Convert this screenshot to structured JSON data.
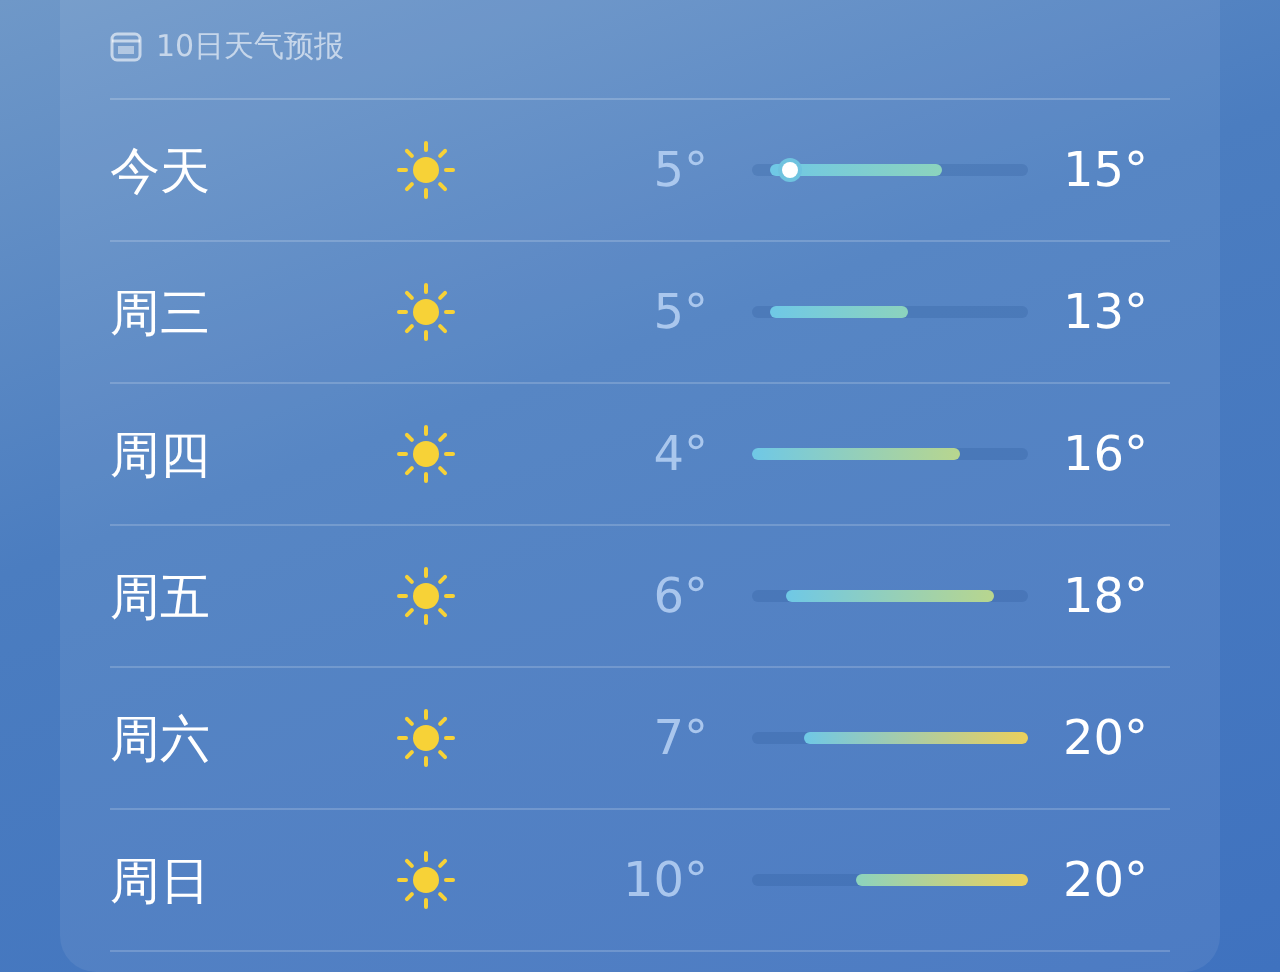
{
  "forecast": {
    "title": "10日天气预报",
    "days": [
      {
        "day": "今天",
        "kind": "sun",
        "low": "5°",
        "high": "15°",
        "now_marker": true,
        "level": 0.12
      },
      {
        "day": "周三",
        "kind": "sun",
        "low": "5°",
        "high": "13°",
        "now_marker": false
      },
      {
        "day": "周四",
        "kind": "sun",
        "low": "4°",
        "high": "16°",
        "now_marker": false
      },
      {
        "day": "周五",
        "kind": "sun",
        "low": "6°",
        "high": "18°",
        "now_marker": false
      },
      {
        "day": "周六",
        "kind": "sun",
        "low": "7°",
        "high": "20°",
        "now_marker": false
      },
      {
        "day": "周日",
        "kind": "sun",
        "low": "10°",
        "high": "20°",
        "now_marker": false
      }
    ]
  }
}
